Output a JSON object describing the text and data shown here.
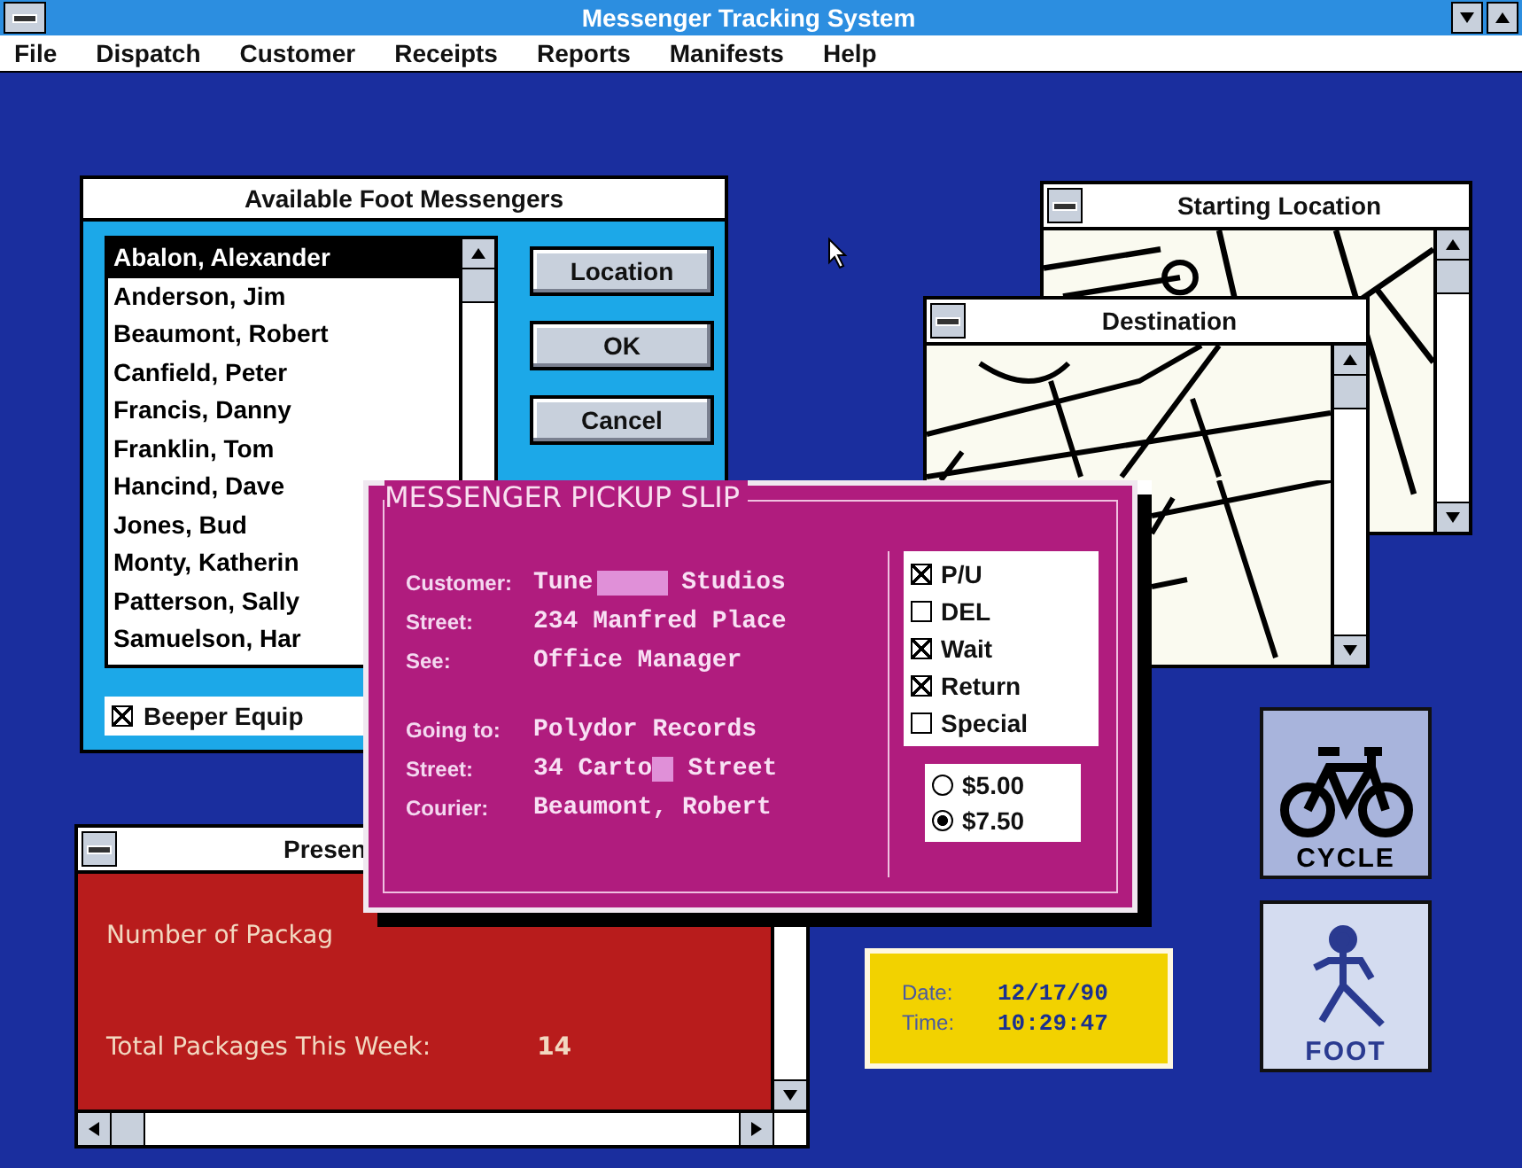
{
  "window": {
    "title": "Messenger Tracking System"
  },
  "menu": [
    "File",
    "Dispatch",
    "Customer",
    "Receipts",
    "Reports",
    "Manifests",
    "Help"
  ],
  "messengers": {
    "title": "Available Foot Messengers",
    "items": [
      {
        "name": "Abalon, Alexander",
        "selected": true
      },
      {
        "name": "Anderson, Jim",
        "selected": false
      },
      {
        "name": "Beaumont, Robert",
        "selected": false
      },
      {
        "name": "Canfield, Peter",
        "selected": false
      },
      {
        "name": "Francis, Danny",
        "selected": false
      },
      {
        "name": "Franklin, Tom",
        "selected": false
      },
      {
        "name": "Hancind, Dave",
        "selected": false
      },
      {
        "name": "Jones, Bud",
        "selected": false
      },
      {
        "name": "Monty, Katherin",
        "selected": false
      },
      {
        "name": "Patterson, Sally",
        "selected": false
      },
      {
        "name": "Samuelson, Har",
        "selected": false
      }
    ],
    "buttons": [
      "Location",
      "OK",
      "Cancel"
    ],
    "beeper": {
      "label": "Beeper Equip",
      "checked": true
    }
  },
  "start_map": {
    "title": "Starting Location"
  },
  "destination_map": {
    "title": "Destination"
  },
  "slip": {
    "title": "MESSENGER PICKUP SLIP",
    "pickup": [
      {
        "label": "Customer:",
        "value_parts": [
          "Tune",
          "Studios"
        ]
      },
      {
        "label": "Street:",
        "value_parts": [
          "234 Manfred Place"
        ]
      },
      {
        "label": "See:",
        "value_parts": [
          "Office Manager"
        ]
      }
    ],
    "delivery": [
      {
        "label": "Going to:",
        "value_parts": [
          "Polydor Records"
        ]
      },
      {
        "label": "Street:",
        "value_parts": [
          "34 Carto",
          "Street"
        ]
      },
      {
        "label": "Courier:",
        "value_parts": [
          "Beaumont, Robert"
        ]
      }
    ],
    "options": [
      {
        "label": "P/U",
        "checked": true
      },
      {
        "label": "DEL",
        "checked": false
      },
      {
        "label": "Wait",
        "checked": true
      },
      {
        "label": "Return",
        "checked": true
      },
      {
        "label": "Special",
        "checked": false
      }
    ],
    "rates": [
      {
        "label": "$5.00",
        "selected": false
      },
      {
        "label": "$7.50",
        "selected": true
      }
    ]
  },
  "packages": {
    "title": "Presen",
    "rows": [
      {
        "label": "Number of Packag"
      },
      {
        "label": "Total Packages This Week:",
        "value": "14"
      }
    ]
  },
  "clock": [
    {
      "label": "Date:",
      "value": "12/17/90"
    },
    {
      "label": "Time:",
      "value": "10:29:47"
    }
  ],
  "modes": [
    {
      "kind": "cycle",
      "label": "CYCLE"
    },
    {
      "kind": "foot",
      "label": "FOOT"
    }
  ]
}
